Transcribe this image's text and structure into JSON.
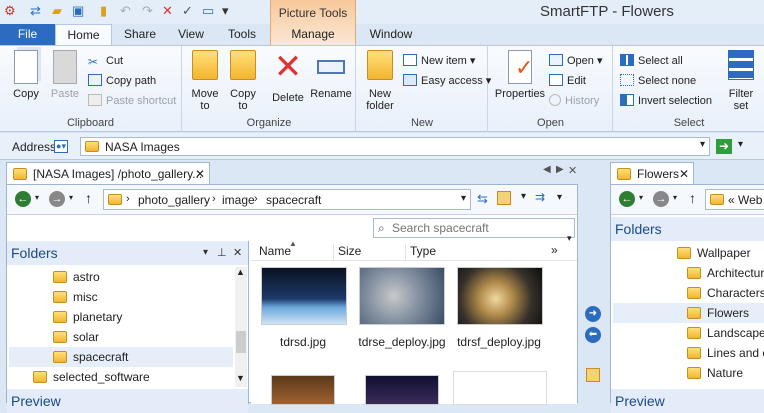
{
  "window": {
    "title": "SmartFTP - Flowers",
    "context_tab": "Picture Tools"
  },
  "tabs": [
    {
      "label": "File"
    },
    {
      "label": "Home"
    },
    {
      "label": "Share"
    },
    {
      "label": "View"
    },
    {
      "label": "Tools"
    },
    {
      "label": "Manage"
    },
    {
      "label": "Window"
    }
  ],
  "ribbon": {
    "clipboard": {
      "label": "Clipboard",
      "copy": "Copy",
      "paste": "Paste",
      "cut": "Cut",
      "copy_path": "Copy path",
      "paste_shortcut": "Paste shortcut"
    },
    "organize": {
      "label": "Organize",
      "move_to": "Move to",
      "copy_to": "Copy to",
      "delete": "Delete",
      "rename": "Rename"
    },
    "new": {
      "label": "New",
      "new_folder": "New folder",
      "new_item": "New item",
      "easy_access": "Easy access"
    },
    "open": {
      "label": "Open",
      "properties": "Properties",
      "open": "Open",
      "edit": "Edit",
      "history": "History"
    },
    "select": {
      "label": "Select",
      "select_all": "Select all",
      "select_none": "Select none",
      "invert_selection": "Invert selection",
      "filter_set": "Filter set"
    }
  },
  "address": {
    "label": "Address",
    "value": "NASA Images"
  },
  "left_panel": {
    "tab_title": "[NASA Images] /photo_gallery...",
    "breadcrumb": [
      "photo_gallery",
      "image",
      "spacecraft"
    ],
    "search_placeholder": "Search spacecraft",
    "folders_title": "Folders",
    "folders": [
      {
        "name": "astro"
      },
      {
        "name": "misc"
      },
      {
        "name": "planetary"
      },
      {
        "name": "solar"
      },
      {
        "name": "spacecraft"
      },
      {
        "name": "selected_software"
      }
    ],
    "preview_title": "Preview",
    "columns": [
      "Name",
      "Size",
      "Type"
    ],
    "files": [
      {
        "name": "tdrsd.jpg"
      },
      {
        "name": "tdrse_deploy.jpg"
      },
      {
        "name": "tdrsf_deploy.jpg"
      }
    ]
  },
  "right_panel": {
    "tab_title": "Flowers",
    "breadcrumb": "« Web",
    "folders_title": "Folders",
    "folders": [
      {
        "name": "Wallpaper"
      },
      {
        "name": "Architecture"
      },
      {
        "name": "Characters"
      },
      {
        "name": "Flowers"
      },
      {
        "name": "Landscapes"
      },
      {
        "name": "Lines and co"
      },
      {
        "name": "Nature"
      }
    ],
    "preview_title": "Preview"
  },
  "colors": {
    "accent": "#2b6cc0",
    "context_tab": "#f7c89a",
    "panel_head": "#1b4a85"
  }
}
